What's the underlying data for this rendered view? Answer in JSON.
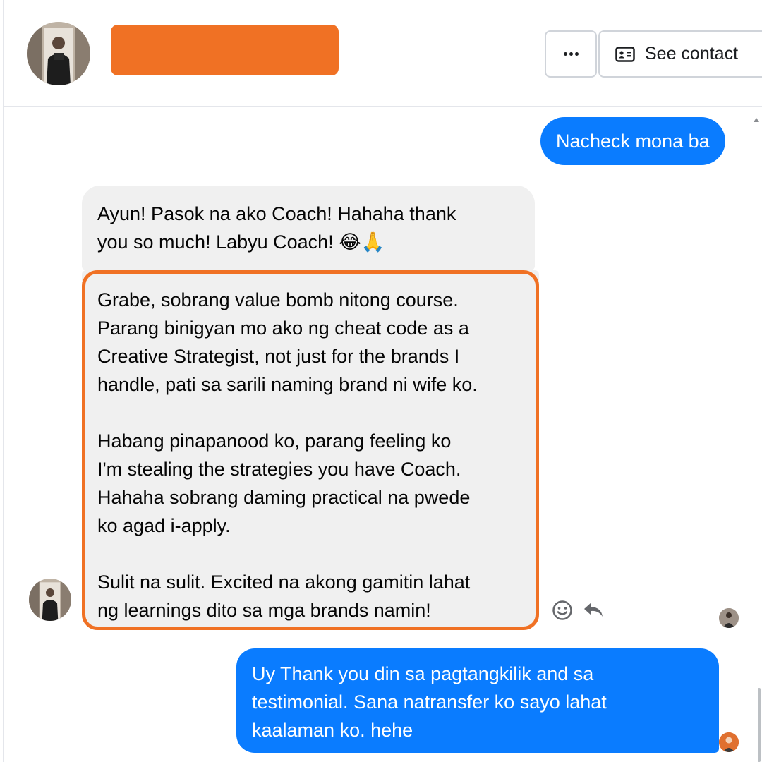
{
  "header": {
    "contact_name_redacted": true,
    "redaction_color": "#f07124",
    "more_label": "More options",
    "see_contact_label": "See contact"
  },
  "messages": [
    {
      "direction": "outgoing",
      "text": "Nacheck mona ba"
    },
    {
      "direction": "incoming",
      "lines": [
        "Ayun! Pasok na ako Coach! Hahaha thank",
        "you so much! Labyu Coach! 😂🙏"
      ]
    },
    {
      "direction": "incoming",
      "highlighted": true,
      "paragraphs": [
        [
          "Grabe, sobrang value bomb nitong course.",
          "Parang binigyan mo ako ng cheat code as a",
          "Creative Strategist, not just for the brands I",
          "handle, pati sa sarili naming brand ni wife ko."
        ],
        [
          "Habang pinapanood ko, parang feeling ko",
          "I'm stealing the strategies you have Coach.",
          "Hahaha sobrang daming practical na pwede",
          "ko agad i-apply."
        ],
        [
          "Sulit na sulit. Excited na akong gamitin lahat",
          "ng learnings dito sa mga brands namin!"
        ]
      ]
    },
    {
      "direction": "outgoing",
      "lines": [
        "Uy Thank you din sa pagtangkilik and sa",
        "testimonial. Sana natransfer ko sayo lahat",
        "kaalaman ko. hehe"
      ]
    }
  ],
  "icons": {
    "react": "smiley-icon",
    "reply": "reply-arrow-icon",
    "contact_card": "contact-card-icon"
  },
  "colors": {
    "outgoing_bubble": "#0a7cff",
    "incoming_bubble": "#f0f0f0",
    "highlight_border": "#f07124"
  }
}
